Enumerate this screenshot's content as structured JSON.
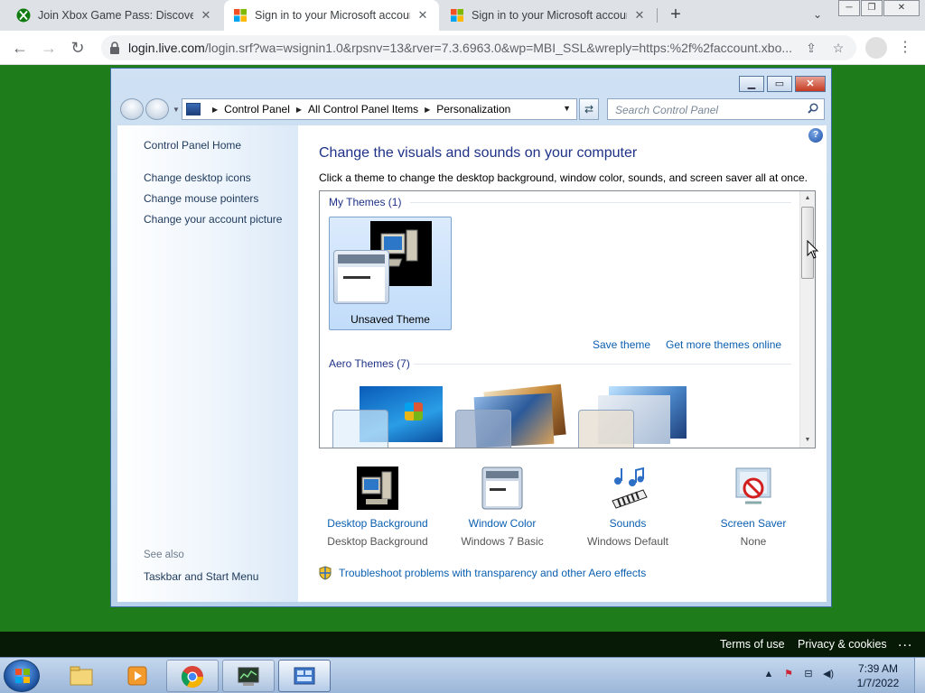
{
  "browser": {
    "tabs": [
      {
        "title": "Join Xbox Game Pass: Discover Y",
        "icon": "xbox-icon"
      },
      {
        "title": "Sign in to your Microsoft accoun",
        "icon": "microsoft-icon"
      },
      {
        "title": "Sign in to your Microsoft accoun",
        "icon": "microsoft-icon"
      }
    ],
    "url_host": "login.live.com",
    "url_rest": "/login.srf?wa=wsignin1.0&rpsnv=13&rver=7.3.6963.0&wp=MBI_SSL&wreply=https:%2f%2faccount.xbo...",
    "window_controls": [
      "minimize",
      "restore",
      "close"
    ]
  },
  "control_panel": {
    "breadcrumb": [
      "Control Panel",
      "All Control Panel Items",
      "Personalization"
    ],
    "search_placeholder": "Search Control Panel",
    "left_links": [
      "Control Panel Home",
      "Change desktop icons",
      "Change mouse pointers",
      "Change your account picture"
    ],
    "see_also_label": "See also",
    "see_also_links": [
      "Taskbar and Start Menu"
    ],
    "heading": "Change the visuals and sounds on your computer",
    "subtext": "Click a theme to change the desktop background, window color, sounds, and screen saver all at once.",
    "my_themes_header": "My Themes (1)",
    "unsaved_theme": "Unsaved Theme",
    "save_theme": "Save theme",
    "get_more_themes": "Get more themes online",
    "aero_themes_header": "Aero Themes (7)",
    "bottom_items": [
      {
        "label": "Desktop Background",
        "value": "Desktop Background",
        "icon": "computer-icon"
      },
      {
        "label": "Window Color",
        "value": "Windows 7 Basic",
        "icon": "window-icon"
      },
      {
        "label": "Sounds",
        "value": "Windows Default",
        "icon": "music-notes-icon"
      },
      {
        "label": "Screen Saver",
        "value": "None",
        "icon": "screen-saver-icon"
      }
    ],
    "troubleshoot": "Troubleshoot problems with transparency and other Aero effects"
  },
  "ms_footer": {
    "terms": "Terms of use",
    "privacy": "Privacy & cookies",
    "more": "..."
  },
  "taskbar": {
    "time": "7:39 AM",
    "date": "1/7/2022"
  }
}
